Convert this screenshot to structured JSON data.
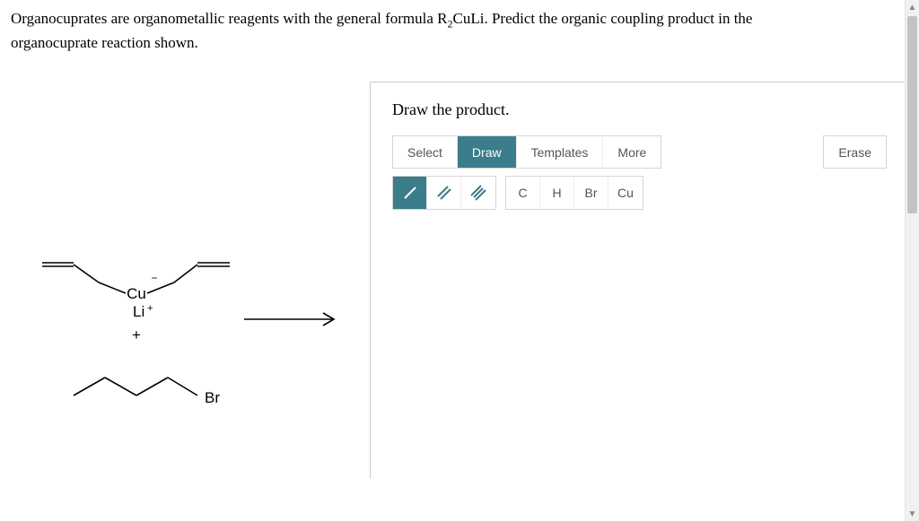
{
  "question": {
    "line1_pre": "Organocuprates are organometallic reagents with the general formula R",
    "line1_sub": "2",
    "line1_post": "CuLi. Predict the organic coupling product in the",
    "line2": "organocuprate reaction shown."
  },
  "reagents": {
    "cu_label": "Cu",
    "cu_charge": "−",
    "li_label": "Li",
    "li_charge": "+",
    "plus": "+",
    "br_label": "Br"
  },
  "editor": {
    "title": "Draw the product.",
    "tabs": {
      "select": "Select",
      "draw": "Draw",
      "templates": "Templates",
      "more": "More"
    },
    "erase": "Erase",
    "elements": {
      "c": "C",
      "h": "H",
      "br": "Br",
      "cu": "Cu"
    }
  }
}
